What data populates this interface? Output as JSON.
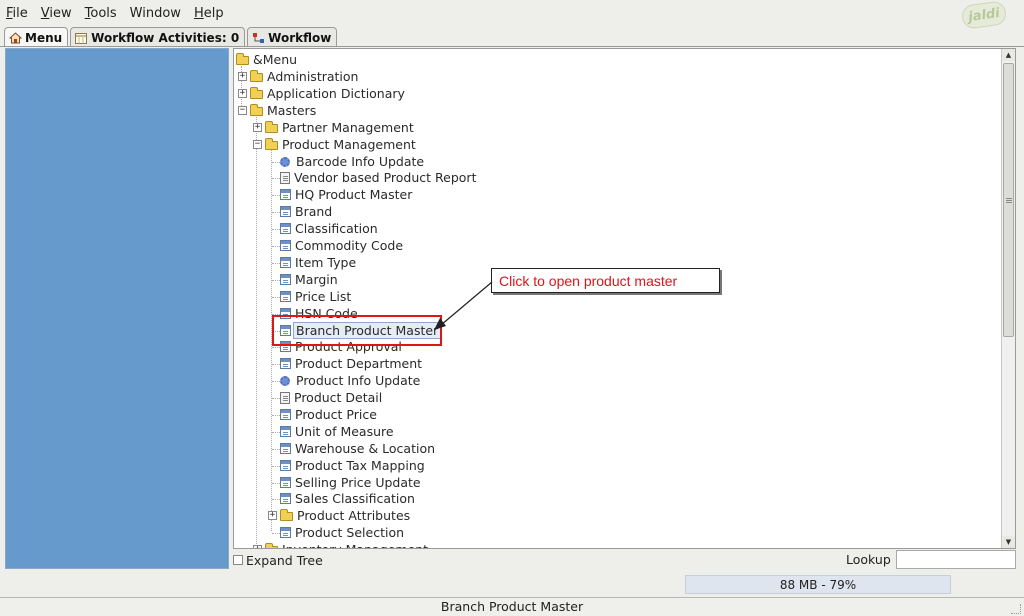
{
  "menubar": {
    "items": [
      {
        "mnemonic": "F",
        "rest": "ile"
      },
      {
        "mnemonic": "V",
        "rest": "iew"
      },
      {
        "mnemonic": "T",
        "rest": "ools"
      },
      {
        "mnemonic": "",
        "rest": "Window"
      },
      {
        "mnemonic": "H",
        "rest": "elp"
      }
    ],
    "logo_text": "jaldi"
  },
  "tabs": {
    "menu": "Menu",
    "workflow_activities": "Workflow Activities: 0",
    "workflow": "Workflow"
  },
  "tree": {
    "root": "&Menu",
    "nodes": [
      {
        "label": "Administration",
        "type": "folder",
        "expanded": false
      },
      {
        "label": "Application Dictionary",
        "type": "folder",
        "expanded": false
      },
      {
        "label": "Masters",
        "type": "folder",
        "expanded": true
      },
      {
        "label": "Partner Management",
        "type": "folder",
        "expanded": false
      },
      {
        "label": "Product Management",
        "type": "folder",
        "expanded": true
      },
      {
        "label": "Barcode Info Update",
        "type": "process"
      },
      {
        "label": "Vendor based Product Report",
        "type": "report"
      },
      {
        "label": "HQ Product Master",
        "type": "window"
      },
      {
        "label": "Brand",
        "type": "window"
      },
      {
        "label": "Classification",
        "type": "window"
      },
      {
        "label": "Commodity Code",
        "type": "window"
      },
      {
        "label": "Item Type",
        "type": "window"
      },
      {
        "label": "Margin",
        "type": "window"
      },
      {
        "label": "Price List",
        "type": "window"
      },
      {
        "label": "HSN Code",
        "type": "window"
      },
      {
        "label": "Branch Product Master",
        "type": "window",
        "selected": true
      },
      {
        "label": "Product Approval",
        "type": "window"
      },
      {
        "label": "Product Department",
        "type": "window"
      },
      {
        "label": "Product Info Update",
        "type": "process"
      },
      {
        "label": "Product Detail",
        "type": "report"
      },
      {
        "label": "Product Price",
        "type": "window"
      },
      {
        "label": "Unit of Measure",
        "type": "window"
      },
      {
        "label": "Warehouse & Location",
        "type": "window"
      },
      {
        "label": "Product Tax Mapping",
        "type": "window"
      },
      {
        "label": "Selling Price Update",
        "type": "window"
      },
      {
        "label": "Sales Classification",
        "type": "window"
      },
      {
        "label": "Product Attributes",
        "type": "folder",
        "expanded": false
      },
      {
        "label": "Product Selection",
        "type": "window"
      },
      {
        "label": "Inventory Management",
        "type": "folder",
        "expanded": false
      }
    ]
  },
  "callout": {
    "text": "Click to open product master",
    "color": "#e0121a"
  },
  "bottom": {
    "expand_tree": "Expand Tree",
    "lookup_label": "Lookup",
    "lookup_value": ""
  },
  "memory": {
    "text": "88 MB - 79%"
  },
  "status": {
    "text": "Branch Product Master"
  },
  "colors": {
    "left_panel": "#6699cc",
    "highlight_box": "#e01616"
  }
}
